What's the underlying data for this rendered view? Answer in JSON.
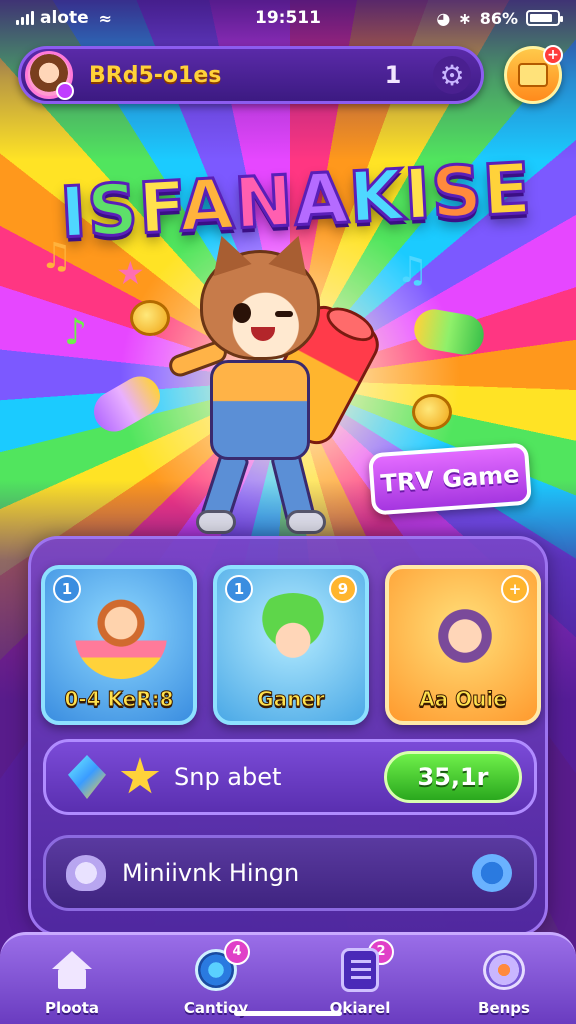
{
  "status_bar": {
    "carrier": "alote",
    "time": "19:511",
    "battery": "86%",
    "battery_level": 0.86
  },
  "top_bar": {
    "player_name": "BRd5-o1es",
    "level": "1",
    "settings_icon": "gear-icon",
    "shop_icon": "shop-bag-icon"
  },
  "logo": {
    "letters": [
      "I",
      "S",
      "F",
      "A",
      "N",
      "A",
      "K",
      "I",
      "S",
      "E"
    ]
  },
  "hero": {
    "try_button_label": "TRV Game"
  },
  "cards": [
    {
      "badge": "1",
      "label": "0-4 KeR:8"
    },
    {
      "badge": "1",
      "badge_right": "9",
      "label": "Ganer"
    },
    {
      "badge_right": "+",
      "label": "Aa Ouie"
    }
  ],
  "reward_row": {
    "text": "Snp abet",
    "button_label": "35,1r"
  },
  "mini_row": {
    "text": "Miniivnk Hingn"
  },
  "nav": [
    {
      "label": "Ploota",
      "icon": "home-icon"
    },
    {
      "label": "Cantioy",
      "icon": "compass-icon",
      "badge": "4"
    },
    {
      "label": "Okiarel",
      "icon": "list-icon",
      "badge": "2"
    },
    {
      "label": "Benps",
      "icon": "chat-icon"
    }
  ],
  "colors": {
    "accent_purple": "#7b4bd8",
    "logo_yellow": "#ffe14d",
    "claim_green": "#2aa81e",
    "try_pink": "#d84dff"
  }
}
